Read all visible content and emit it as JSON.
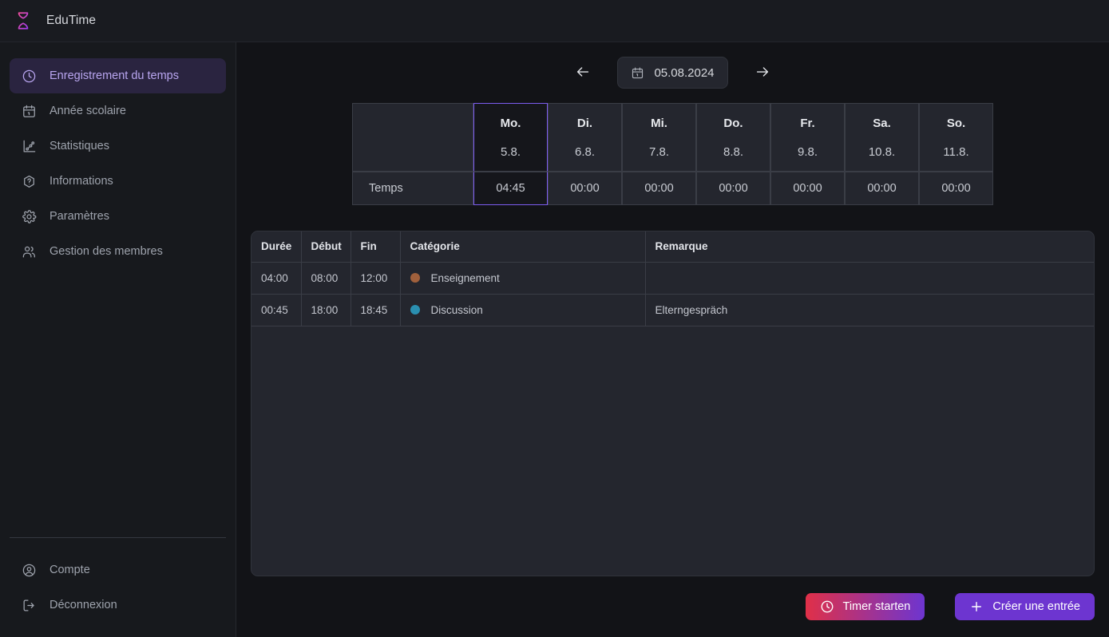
{
  "app": {
    "title": "EduTime",
    "logo_icon": "hourglass-icon",
    "accent_purple": "#6d35d0",
    "accent_red": "#e03048",
    "sidebar_active_bg": "#2a2440",
    "sidebar_active_fg": "#b9a6f0",
    "selected_column_border": "#7c5cf0"
  },
  "sidebar": {
    "items": [
      {
        "label": "Enregistrement du temps",
        "icon": "clock-icon",
        "active": true
      },
      {
        "label": "Année scolaire",
        "icon": "calendar-icon",
        "active": false
      },
      {
        "label": "Statistiques",
        "icon": "line-chart-icon",
        "active": false
      },
      {
        "label": "Informations",
        "icon": "help-hexagon-icon",
        "active": false
      },
      {
        "label": "Paramètres",
        "icon": "gear-icon",
        "active": false
      },
      {
        "label": "Gestion des membres",
        "icon": "users-icon",
        "active": false
      }
    ],
    "bottom_items": [
      {
        "label": "Compte",
        "icon": "user-circle-icon"
      },
      {
        "label": "Déconnexion",
        "icon": "logout-icon"
      }
    ]
  },
  "date_nav": {
    "prev_icon": "arrow-left-icon",
    "next_icon": "arrow-right-icon",
    "calendar_icon": "calendar-icon",
    "current_date": "05.08.2024"
  },
  "week_summary": {
    "row_label": "Temps",
    "days": [
      {
        "dow": "Mo.",
        "date": "5.8.",
        "time": "04:45",
        "selected": true
      },
      {
        "dow": "Di.",
        "date": "6.8.",
        "time": "00:00",
        "selected": false
      },
      {
        "dow": "Mi.",
        "date": "7.8.",
        "time": "00:00",
        "selected": false
      },
      {
        "dow": "Do.",
        "date": "8.8.",
        "time": "00:00",
        "selected": false
      },
      {
        "dow": "Fr.",
        "date": "9.8.",
        "time": "00:00",
        "selected": false
      },
      {
        "dow": "Sa.",
        "date": "10.8.",
        "time": "00:00",
        "selected": false
      },
      {
        "dow": "So.",
        "date": "11.8.",
        "time": "00:00",
        "selected": false
      }
    ]
  },
  "entries": {
    "columns": [
      "Durée",
      "Début",
      "Fin",
      "Catégorie",
      "Remarque"
    ],
    "rows": [
      {
        "duree": "04:00",
        "debut": "08:00",
        "fin": "12:00",
        "categorie": "Enseignement",
        "categorie_color": "#a0603c",
        "remarque": ""
      },
      {
        "duree": "00:45",
        "debut": "18:00",
        "fin": "18:45",
        "categorie": "Discussion",
        "categorie_color": "#2a8fb0",
        "remarque": "Elterngespräch"
      }
    ]
  },
  "footer": {
    "timer_button": {
      "label": "Timer starten",
      "icon": "clock-icon"
    },
    "create_button": {
      "label": "Créer une entrée",
      "icon": "plus-icon"
    }
  }
}
